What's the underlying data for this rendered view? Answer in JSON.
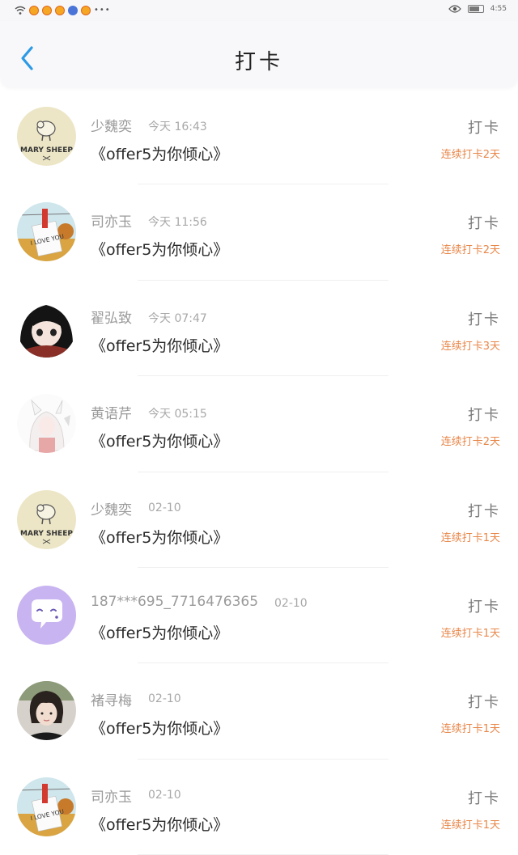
{
  "status_bar": {
    "dots": "•••",
    "time": "4:55"
  },
  "header": {
    "title": "打卡"
  },
  "items": [
    {
      "name": "少魏奕",
      "time": "今天 16:43",
      "message": "《offer5为你倾心》",
      "action": "打卡",
      "streak": "连续打卡2天",
      "avatar": "mary-sheep-avatar"
    },
    {
      "name": "司亦玉",
      "time": "今天 11:56",
      "message": "《offer5为你倾心》",
      "action": "打卡",
      "streak": "连续打卡2天",
      "avatar": "i-love-you-note-avatar"
    },
    {
      "name": "翟弘致",
      "time": "今天 07:47",
      "message": "《offer5为你倾心》",
      "action": "打卡",
      "streak": "连续打卡3天",
      "avatar": "anime-girl-avatar"
    },
    {
      "name": "黄语芹",
      "time": "今天 05:15",
      "message": "《offer5为你倾心》",
      "action": "打卡",
      "streak": "连续打卡2天",
      "avatar": "anime-fox-girl-avatar"
    },
    {
      "name": "少魏奕",
      "time": "02-10",
      "message": "《offer5为你倾心》",
      "action": "打卡",
      "streak": "连续打卡1天",
      "avatar": "mary-sheep-avatar"
    },
    {
      "name": "187***695_7716476365",
      "time": "02-10",
      "message": "《offer5为你倾心》",
      "action": "打卡",
      "streak": "连续打卡1天",
      "avatar": "chat-bubble-avatar"
    },
    {
      "name": "褚寻梅",
      "time": "02-10",
      "message": "《offer5为你倾心》",
      "action": "打卡",
      "streak": "连续打卡1天",
      "avatar": "photo-person-avatar"
    },
    {
      "name": "司亦玉",
      "time": "02-10",
      "message": "《offer5为你倾心》",
      "action": "打卡",
      "streak": "连续打卡1天",
      "avatar": "i-love-you-note-avatar"
    }
  ],
  "avatar_texts": {
    "mary_sheep": "MARY SHEEP",
    "i_love_you": "I LOVE YOU"
  },
  "colors": {
    "accent": "#2d9ae6",
    "streak": "#e8874a"
  }
}
